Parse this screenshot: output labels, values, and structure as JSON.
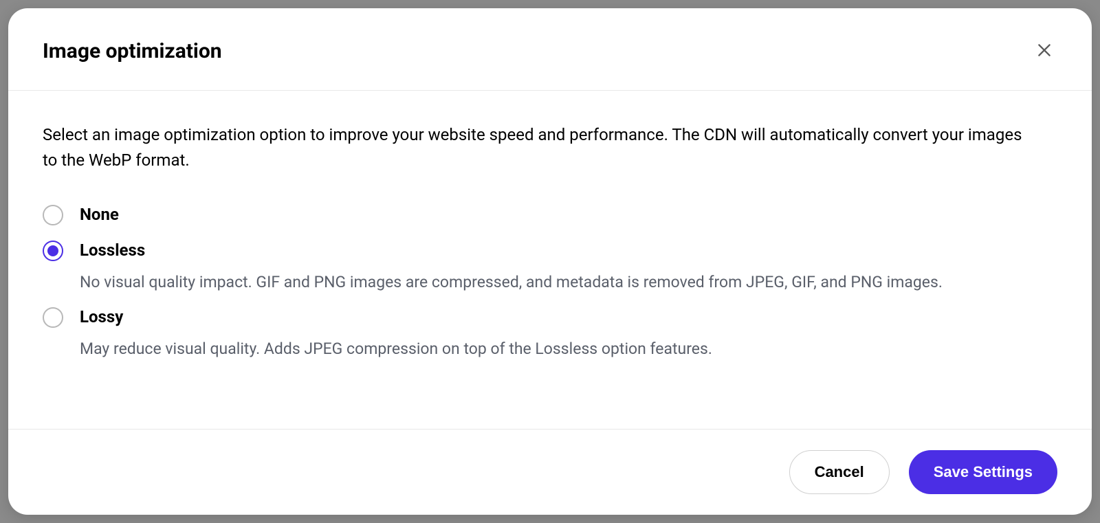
{
  "modal": {
    "title": "Image optimization",
    "intro": "Select an image optimization option to improve your website speed and performance. The CDN will automatically convert your images to the WebP format.",
    "options": [
      {
        "id": "none",
        "label": "None",
        "description": "",
        "checked": false
      },
      {
        "id": "lossless",
        "label": "Lossless",
        "description": "No visual quality impact. GIF and PNG images are compressed, and metadata is removed from JPEG, GIF, and PNG images.",
        "checked": true
      },
      {
        "id": "lossy",
        "label": "Lossy",
        "description": "May reduce visual quality. Adds JPEG compression on top of the Lossless option features.",
        "checked": false
      }
    ],
    "buttons": {
      "cancel": "Cancel",
      "save": "Save Settings"
    }
  },
  "colors": {
    "accent": "#4B2EE5",
    "border": "#e8e8e8",
    "textMuted": "#5a5f6a"
  }
}
